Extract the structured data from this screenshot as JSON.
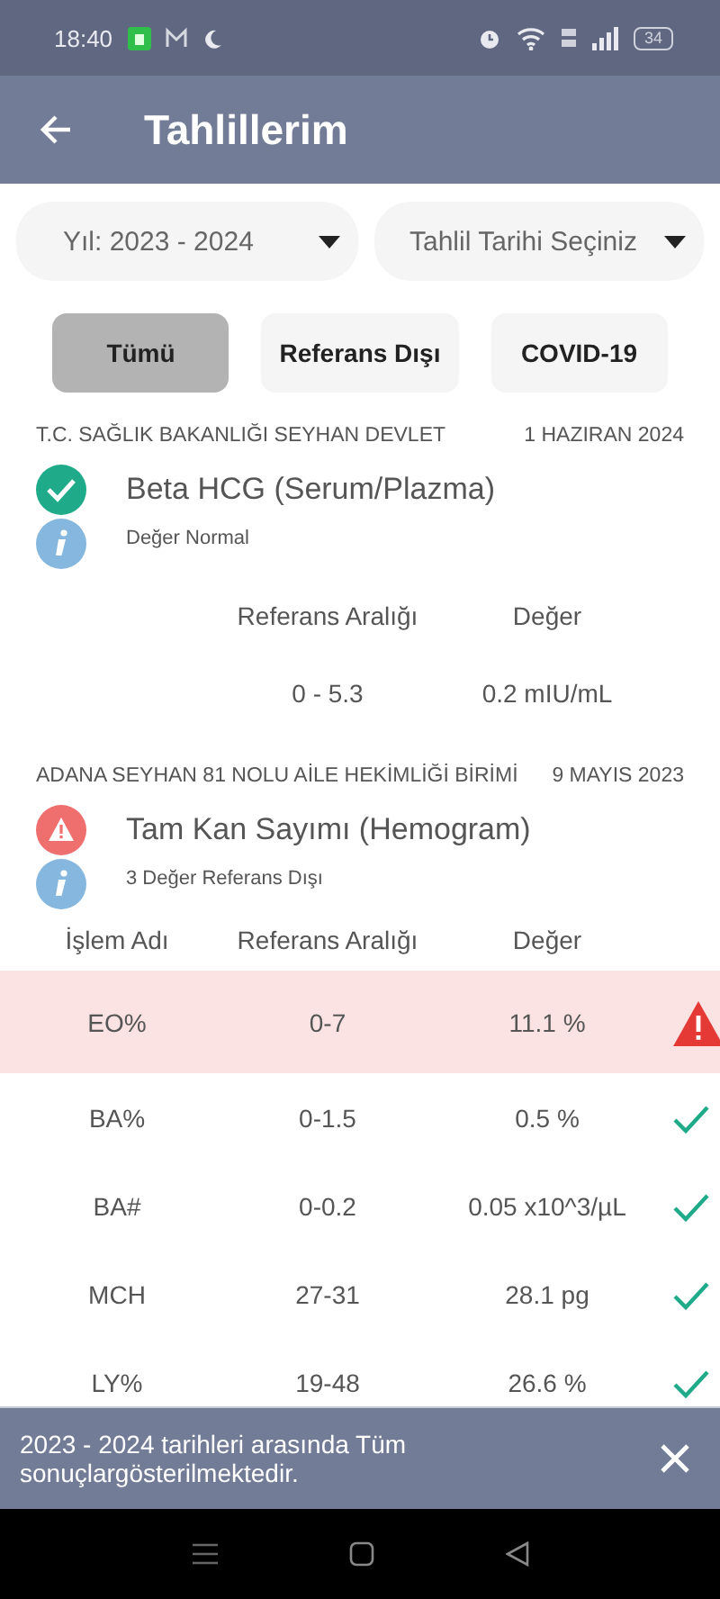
{
  "status_bar": {
    "time": "18:40",
    "battery": "34"
  },
  "app_bar": {
    "title": "Tahlillerim"
  },
  "dropdowns": [
    {
      "label": "Yıl: 2023 - 2024"
    },
    {
      "label": "Tahlil Tarihi Seçiniz"
    }
  ],
  "filters": [
    {
      "label": "Tümü",
      "selected": true
    },
    {
      "label": "Referans Dışı",
      "selected": false
    },
    {
      "label": "COVID-19",
      "selected": false
    }
  ],
  "results": [
    {
      "institution": "T.C. SAĞLIK BAKANLIĞI SEYHAN DEVLET",
      "date": "1 HAZIRAN 2024",
      "kind": "normal",
      "title": "Beta HCG (Serum/Plazma)",
      "note": "Değer Normal",
      "columns": [
        "",
        "Referans Aralığı",
        "Değer"
      ],
      "rows": [
        {
          "name": "",
          "range": "0 - 5.3",
          "value": "0.2 mIU/mL",
          "kind": "plain"
        }
      ]
    },
    {
      "institution": "ADANA SEYHAN 81 NOLU AİLE HEKİMLİĞİ BİRİMİ",
      "date": "9 MAYIS 2023",
      "kind": "abnormal",
      "title": "Tam Kan Sayımı (Hemogram)",
      "note": "3 Değer Referans Dışı",
      "columns": [
        "İşlem Adı",
        "Referans Aralığı",
        "Değer"
      ],
      "rows": [
        {
          "name": "EO%",
          "range": "0-7",
          "value": "11.1 %",
          "kind": "flagged",
          "out_of_range": true
        },
        {
          "name": "BA%",
          "range": "0-1.5",
          "value": "0.5 %",
          "kind": "flagged",
          "out_of_range": false
        },
        {
          "name": "BA#",
          "range": "0-0.2",
          "value": "0.05 x10^3/µL",
          "kind": "flagged",
          "out_of_range": false
        },
        {
          "name": "MCH",
          "range": "27-31",
          "value": "28.1 pg",
          "kind": "flagged",
          "out_of_range": false
        },
        {
          "name": "LY%",
          "range": "19-48",
          "value": "26.6 %",
          "kind": "flagged",
          "out_of_range": false
        }
      ]
    }
  ],
  "snackbar": {
    "message": "2023 - 2024 tarihleri arasında Tüm sonuçlargösterilmektedir."
  }
}
